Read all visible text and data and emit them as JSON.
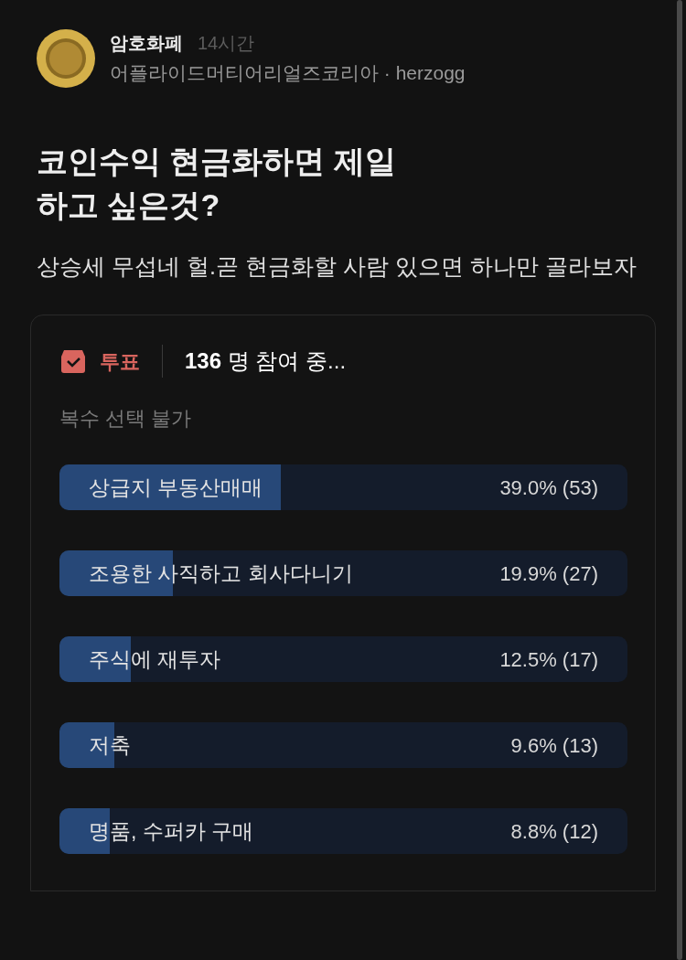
{
  "post": {
    "community": "암호화폐",
    "time": "14시간",
    "author_line": "어플라이드머티어리얼즈코리아 · herzogg",
    "title_lines": [
      "코인수익 현금화하면 제일",
      "하고 싶은것?"
    ],
    "body": "상승세 무섭네 헐.곧 현금화할 사람 있으면 하나만 골라보자"
  },
  "poll": {
    "label": "투표",
    "count": "136",
    "count_suffix": "명 참여 중...",
    "note": "복수 선택 불가",
    "options": [
      {
        "text": "상급지 부동산매매",
        "result": "39.0% (53)",
        "level": 0.39
      },
      {
        "text": "조용한 사직하고 회사다니기",
        "result": "19.9% (27)",
        "level": 0.199
      },
      {
        "text": "주식에 재투자",
        "result": "12.5% (17)",
        "level": 0.125
      },
      {
        "text": "저축",
        "result": "9.6% (13)",
        "level": 0.096
      },
      {
        "text": "명품, 수퍼카 구매",
        "result": "8.8% (12)",
        "level": 0.088
      }
    ]
  }
}
